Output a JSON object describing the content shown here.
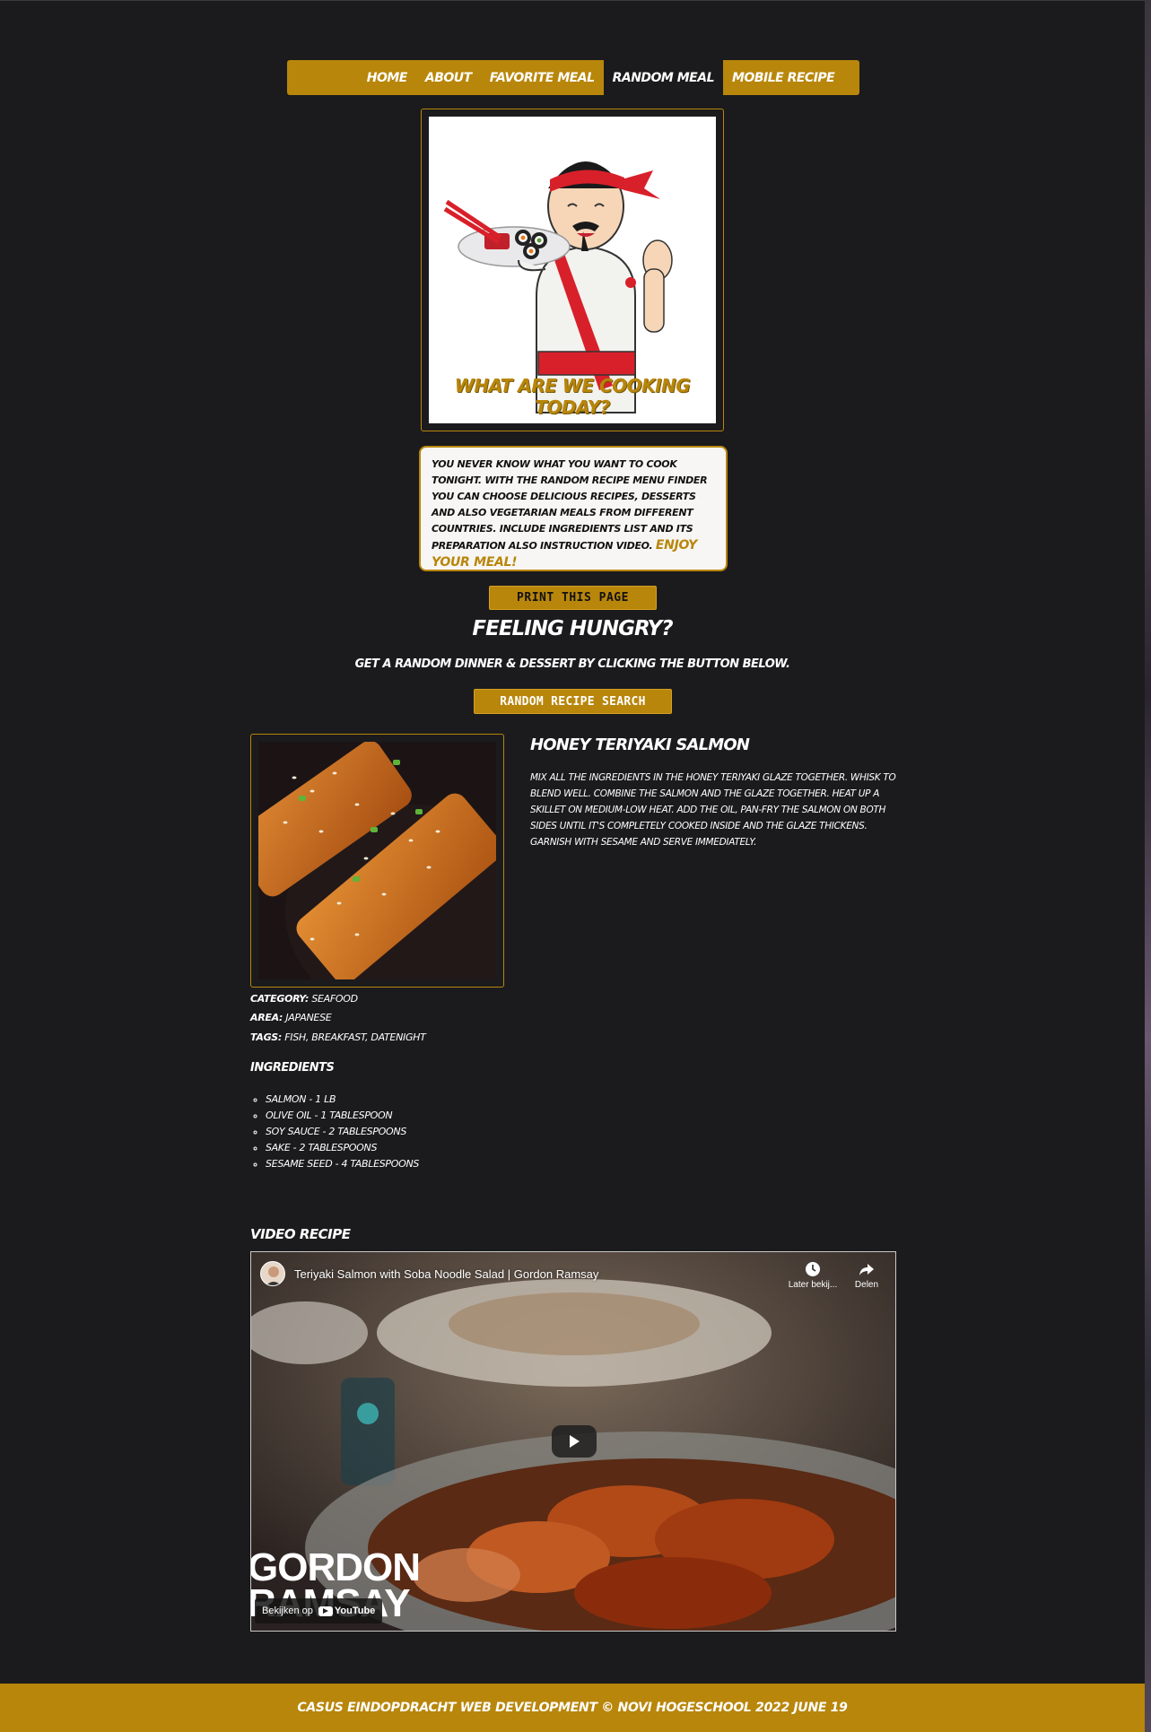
{
  "nav": {
    "items": [
      {
        "label": "HOME"
      },
      {
        "label": "ABOUT"
      },
      {
        "label": "FAVORITE MEAL"
      },
      {
        "label": "RANDOM MEAL"
      },
      {
        "label": "MOBILE RECIPE"
      }
    ],
    "active_index": 3
  },
  "hero": {
    "caption": "WHAT ARE WE COOKING TODAY?"
  },
  "intro": {
    "text": "YOU NEVER KNOW WHAT YOU WANT TO COOK TONIGHT. WITH THE RANDOM RECIPE MENU FINDER YOU CAN CHOOSE DELICIOUS RECIPES, DESSERTS AND ALSO VEGETARIAN MEALS FROM DIFFERENT COUNTRIES. INCLUDE INGREDIENTS LIST AND ITS PREPARATION ALSO INSTRUCTION VIDEO.",
    "enjoy": "ENJOY YOUR MEAL!"
  },
  "print_button": "PRINT THIS PAGE",
  "hungry_title": "FEELING HUNGRY?",
  "subline": "GET A RANDOM DINNER & DESSERT BY CLICKING THE BUTTON BELOW.",
  "random_button": "RANDOM RECIPE SEARCH",
  "meal": {
    "title": "HONEY TERIYAKI SALMON",
    "instructions": "MIX ALL THE INGREDIENTS IN THE HONEY TERIYAKI GLAZE TOGETHER. WHISK TO BLEND WELL. COMBINE THE SALMON AND THE GLAZE TOGETHER. HEAT UP A SKILLET ON MEDIUM-LOW HEAT. ADD THE OIL, PAN-FRY THE SALMON ON BOTH SIDES UNTIL IT'S COMPLETELY COOKED INSIDE AND THE GLAZE THICKENS. GARNISH WITH SESAME AND SERVE IMMEDIATELY.",
    "category_label": "CATEGORY:",
    "category": "SEAFOOD",
    "area_label": "AREA:",
    "area": "JAPANESE",
    "tags_label": "TAGS:",
    "tags": "FISH, BREAKFAST, DATENIGHT",
    "ingredients_title": "INGREDIENTS",
    "ingredients": [
      "SALMON - 1 LB",
      "OLIVE OIL - 1 TABLESPOON",
      "SOY SAUCE - 2 TABLESPOONS",
      "SAKE - 2 TABLESPOONS",
      "SESAME SEED - 4 TABLESPOONS"
    ]
  },
  "video": {
    "section_title": "VIDEO RECIPE",
    "title": "Teriyaki Salmon with Soba Noodle Salad | Gordon Ramsay",
    "watch_later": "Later bekij...",
    "share": "Delen",
    "watch_on": "Bekijken op",
    "youtube": "YouTube",
    "overlay_line1": "GORDON",
    "overlay_line2": "RAMSAY"
  },
  "footer": "CASUS EINDOPDRACHT WEB DEVELOPMENT © NOVI HOGESCHOOL 2022 JUNE 19",
  "colors": {
    "background": "#1b1b1d",
    "accent": "#b8860b",
    "text": "#ffffff"
  }
}
